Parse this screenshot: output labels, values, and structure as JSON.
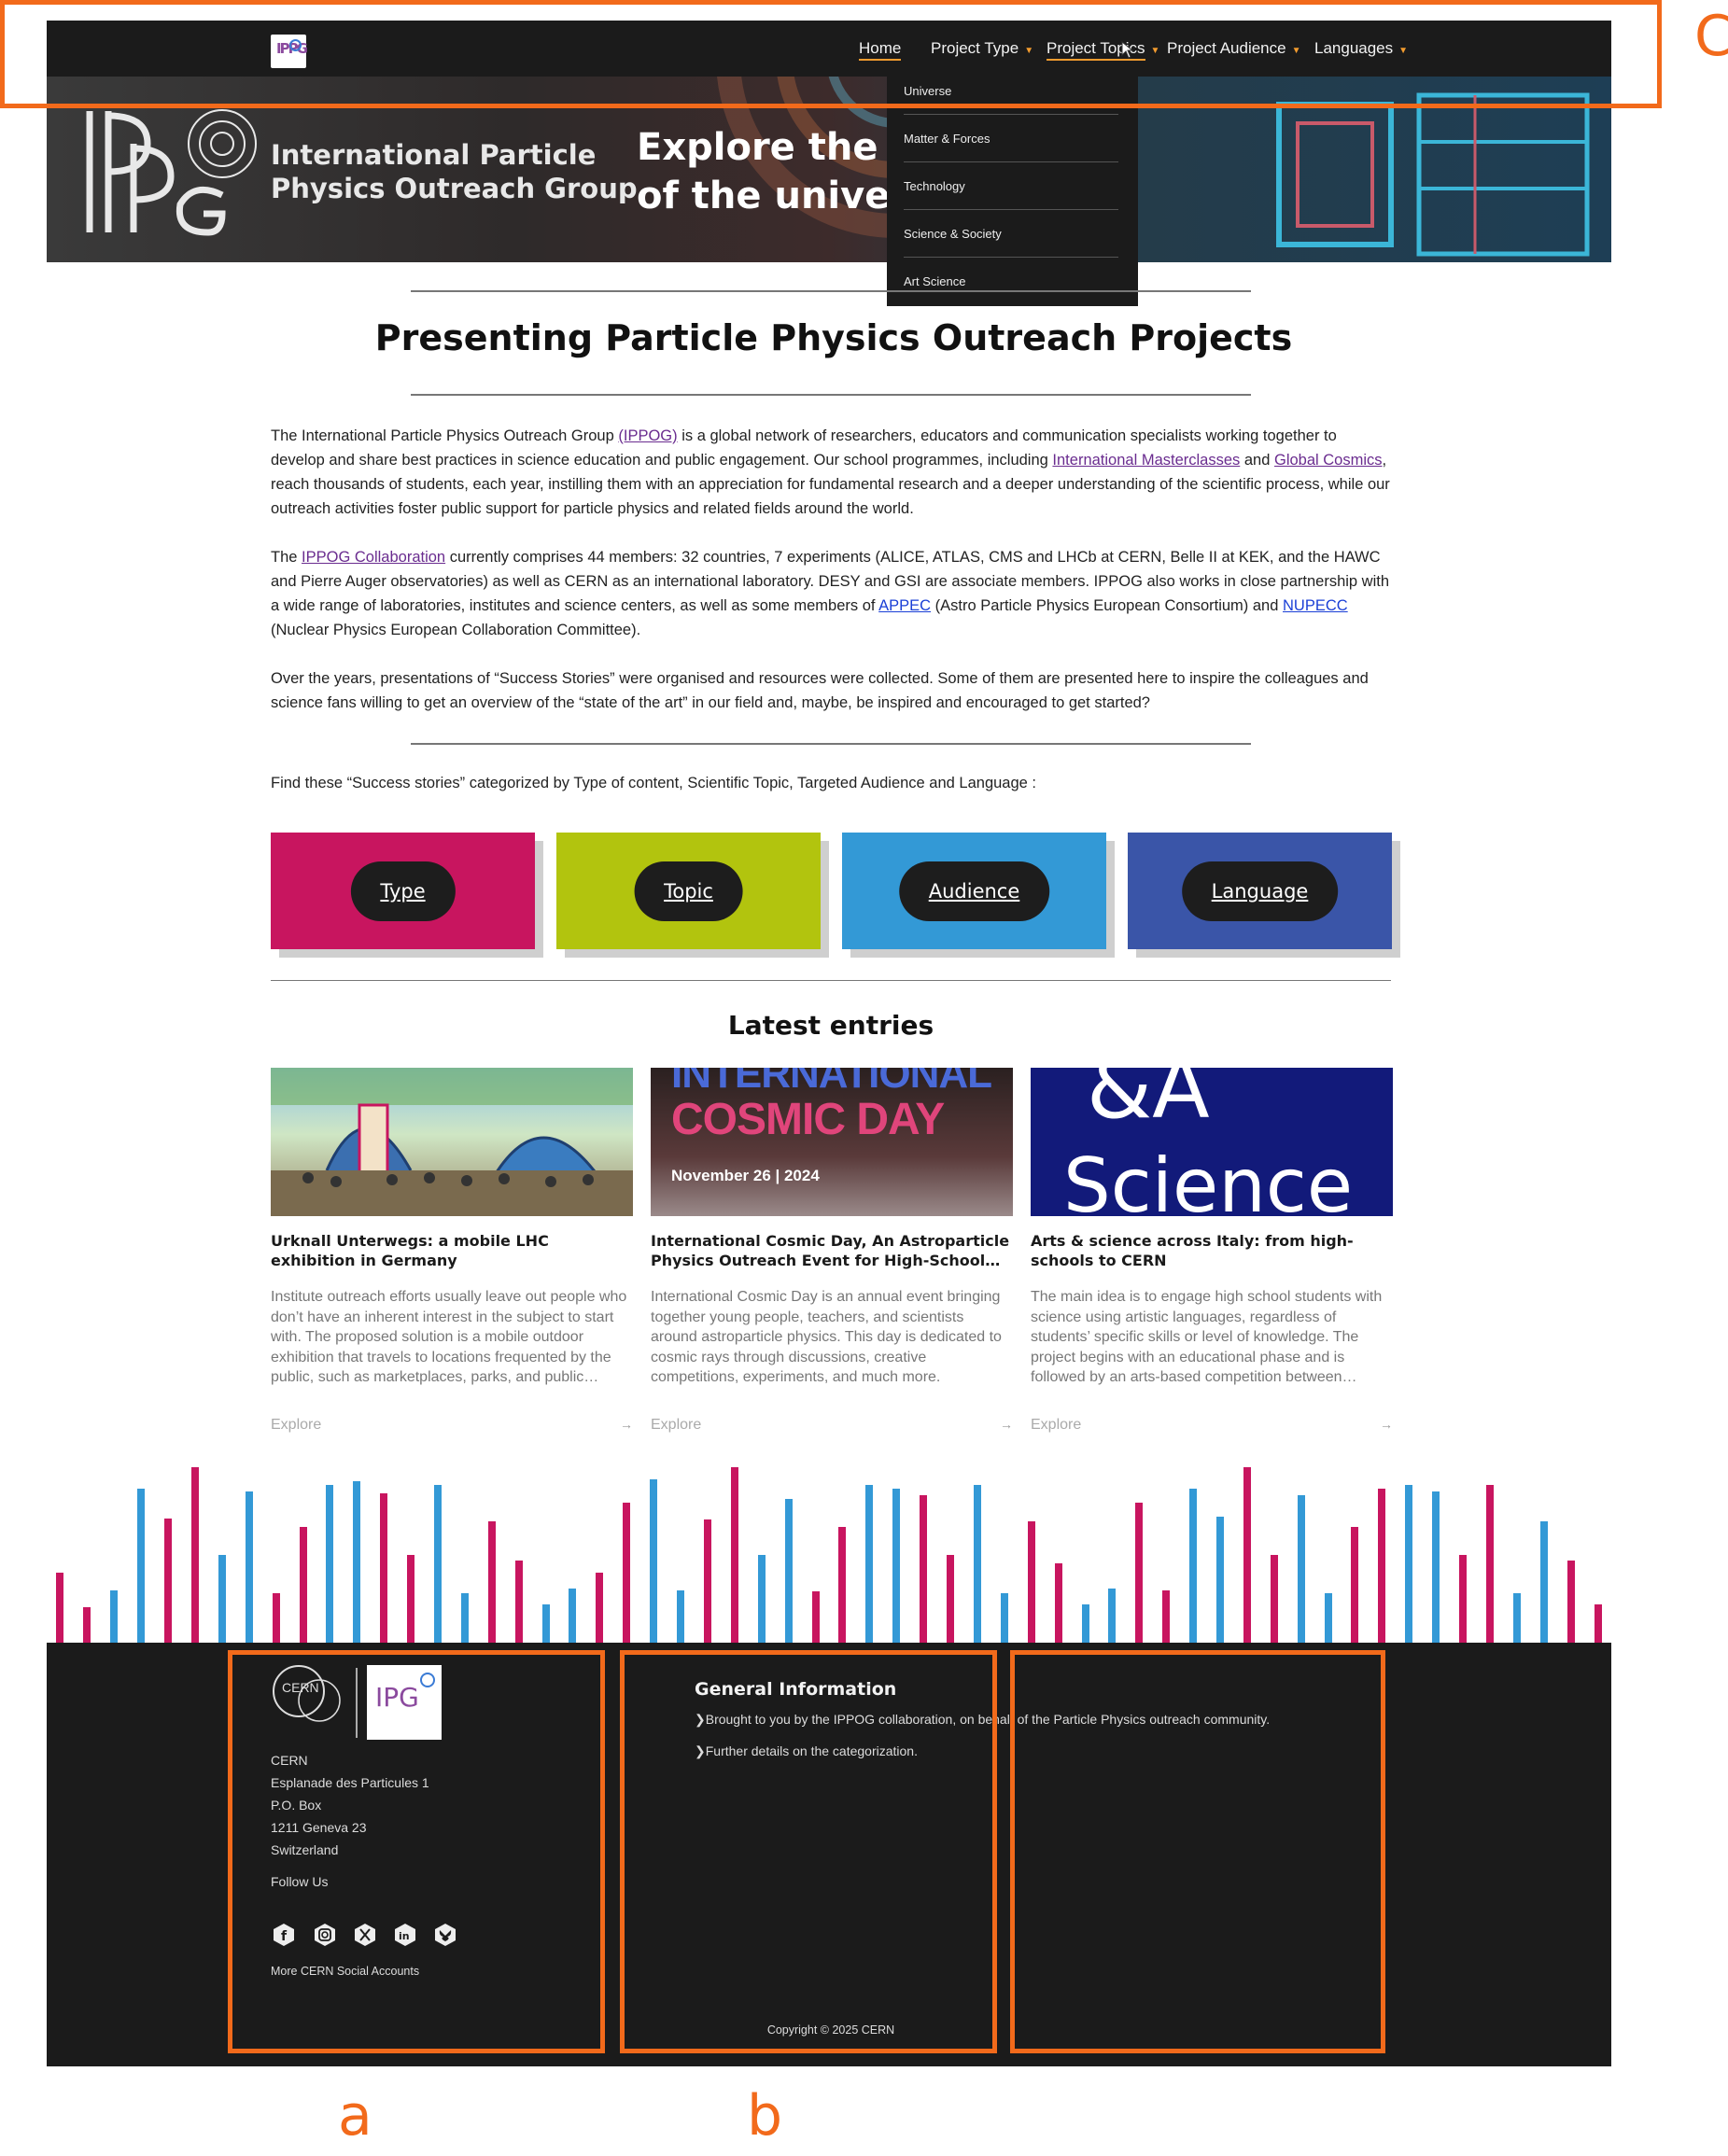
{
  "nav": {
    "logo_text": "IPPG",
    "items": [
      {
        "label": "Home"
      },
      {
        "label": "Project Type"
      },
      {
        "label": "Project Topics"
      },
      {
        "label": "Project Audience"
      },
      {
        "label": "Languages"
      }
    ],
    "dropdown": [
      "Universe",
      "Matter & Forces",
      "Technology",
      "Science & Society",
      "Art Science"
    ]
  },
  "hero": {
    "org_line1": "International Particle",
    "org_line2": "Physics Outreach Group",
    "tagline_line1": "Explore the fo",
    "tagline_line2": "of the univers"
  },
  "main": {
    "title": "Presenting Particle Physics Outreach Projects",
    "p1": {
      "t1": "The International Particle Physics Outreach Group ",
      "link_ippog": "(IPPOG)",
      "t2": " is a global network of researchers, educators and communication specialists working together to develop and share best practices in science education and public engagement. Our school programmes, including ",
      "link_masterclasses": "International Masterclasses",
      "t3": " and ",
      "link_cosmics": "Global Cosmics",
      "t4": ", reach thousands of students, each year, instilling them with an appreciation for fundamental research and a deeper understanding of the scientific process, while our outreach activities foster public support for particle physics and related fields around the world."
    },
    "p2": {
      "t1": "The ",
      "link_collab": "IPPOG Collaboration",
      "t2": " currently comprises 44 members: 32 countries, 7 experiments (ALICE, ATLAS, CMS and LHCb at CERN, Belle II at KEK, and the HAWC and Pierre Auger observatories) as well as CERN as an international laboratory. DESY and GSI are associate members. IPPOG also works in close partnership with a wide range of laboratories, institutes and science centers, as well as some members of ",
      "link_appec": "APPEC",
      "t3": " (Astro Particle Physics European Consortium) and ",
      "link_nupecc": "NUPECC",
      "t4": " (Nuclear Physics European Collaboration Committee)."
    },
    "p3": "Over the years, presentations of “Success Stories” were organised and resources were collected. Some of them are presented here to inspire the colleagues and science fans willing to get an overview of the “state of the art” in our field and, maybe, be inspired and encouraged to get started?",
    "find_text": "Find these “Success stories” categorized by Type of content, Scientific Topic, Targeted Audience and Language :"
  },
  "categories": [
    {
      "label": "Type",
      "color": "#c8155f"
    },
    {
      "label": "Topic",
      "color": "#b2c40e"
    },
    {
      "label": "Audience",
      "color": "#3399d6"
    },
    {
      "label": "Language",
      "color": "#3a55a8"
    }
  ],
  "latest": {
    "title": "Latest entries",
    "cards": [
      {
        "title": "Urknall Unterwegs: a mobile LHC exhibition in Germany",
        "desc": "Institute outreach efforts usually leave out people who don’t have an inherent interest in the subject to start with. The proposed solution is a mobile outdoor exhibition that travels to locations frequented by the public, such as marketplaces, parks, and public…",
        "explore": "Explore"
      },
      {
        "title": "International Cosmic Day, An Astroparticle Physics Outreach Event for High-School…",
        "desc": "International Cosmic Day is an annual event bringing together young people, teachers, and scientists around astroparticle physics. This day is dedicated to cosmic rays through discussions, creative competitions, experiments, and much more.",
        "explore": "Explore",
        "img_line1": "INTERNATIONAL",
        "img_line2": "COSMIC DAY",
        "img_date": "November 26 | 2024"
      },
      {
        "title": "Arts & science across Italy: from high-schools to CERN",
        "desc": "The main idea is to engage high school students with science using artistic languages, regardless of students’ specific skills or level of knowledge. The project begins with an educational phase and is followed by an arts-based competition between…",
        "explore": "Explore",
        "img_text1": "&A",
        "img_text2": "Science"
      }
    ]
  },
  "footer": {
    "cern_logo": "CERN",
    "address": [
      "CERN",
      "Esplanade des Particules 1",
      "P.O. Box",
      "1211 Geneva 23",
      "Switzerland"
    ],
    "follow_us": "Follow Us",
    "social": [
      "facebook",
      "instagram",
      "x",
      "linkedin",
      "bluesky"
    ],
    "more_social": "More CERN Social Accounts",
    "general_title": "General Information",
    "general_items": [
      "Brought to you by the IPPOG collaboration, on behalf of the Particle Physics outreach community.",
      "Further details on the categorization."
    ],
    "copyright": "Copyright © 2025 CERN"
  },
  "annotations": {
    "label_c": "C",
    "label_a": "a",
    "label_b": "b",
    "color": "#f26a1b"
  },
  "bar_heights": [
    0.4,
    0.2,
    0.3,
    0.88,
    0.71,
    1.0,
    0.5,
    0.86,
    0.28,
    0.66,
    0.9,
    0.92,
    0.85,
    0.5,
    0.9,
    0.28,
    0.69,
    0.47,
    0.22,
    0.31,
    0.4,
    0.8,
    0.93,
    0.3,
    0.7,
    1.0,
    0.5,
    0.82,
    0.29,
    0.66,
    0.9,
    0.88,
    0.84,
    0.5,
    0.9,
    0.28,
    0.69,
    0.45,
    0.22,
    0.31,
    0.8,
    0.3,
    0.88,
    0.72,
    1.0,
    0.5,
    0.84,
    0.28,
    0.66,
    0.88,
    0.9,
    0.86,
    0.5,
    0.9,
    0.28,
    0.69,
    0.47,
    0.22
  ]
}
